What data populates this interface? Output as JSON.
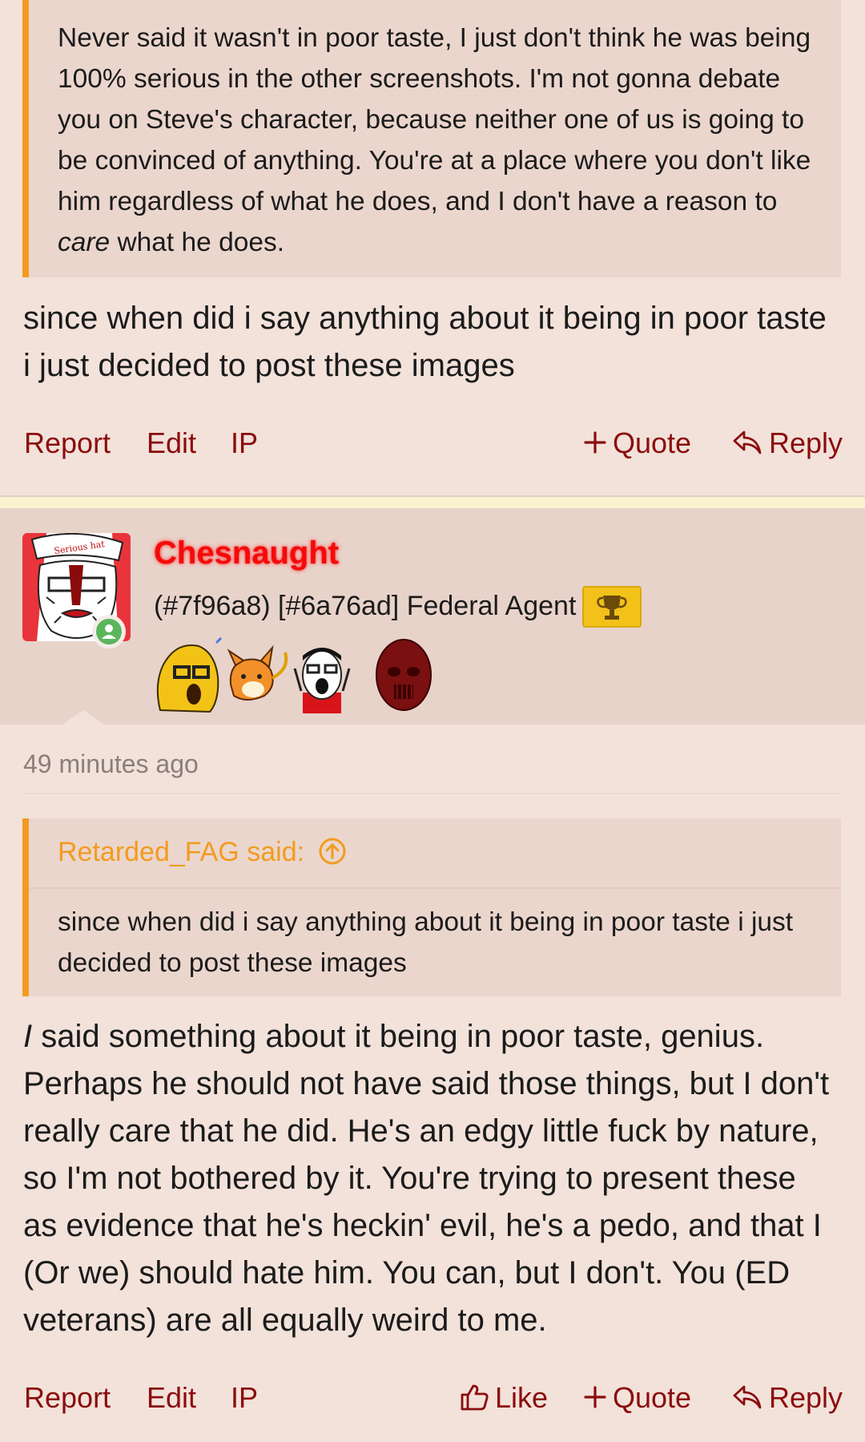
{
  "post1": {
    "quote": {
      "text_part1": "Never said it wasn't in poor taste, I just don't think he was being 100% serious in the other screenshots. I'm not gonna debate you on Steve's character, because neither one of us is going to be convinced of anything. You're at a place where you don't like him regardless of what he does, and I don't have a reason to ",
      "text_em": "care",
      "text_part2": " what he does."
    },
    "body": "since when did i say anything about it being in poor taste i just decided to post these images",
    "actions": {
      "report": "Report",
      "edit": "Edit",
      "ip": "IP",
      "quote": "Quote",
      "reply": "Reply"
    }
  },
  "post2": {
    "author": {
      "username": "Chesnaught",
      "user_title": "(#7f96a8) [#6a76ad] Federal Agent",
      "online_icon": "user-online-icon",
      "trophy_icon": "trophy-icon",
      "avatar_text": "Serious hat"
    },
    "timestamp": "49 minutes ago",
    "quote": {
      "author": "Retarded_FAG said:",
      "text": "since when did i say anything about it being in poor taste i just decided to post these images"
    },
    "body_em": "I",
    "body_rest": " said something about it being in poor taste, genius. Perhaps he should not have said those things, but I don't really care that he did. He's an edgy little fuck by nature, so I'm not bothered by it. You're trying to present these as evidence that he's heckin' evil, he's a pedo, and that I (Or we) should hate him. You can, but I don't. You (ED veterans) are all equally weird to me.",
    "actions": {
      "report": "Report",
      "edit": "Edit",
      "ip": "IP",
      "like": "Like",
      "quote": "Quote",
      "reply": "Reply"
    }
  },
  "colors": {
    "background": "#f2e2da",
    "quote_bg": "#ebd6cd",
    "quote_border": "#f29b1f",
    "action_link": "#8b0d0d",
    "username": "#f50a0a",
    "divider": "#faf3cf"
  }
}
